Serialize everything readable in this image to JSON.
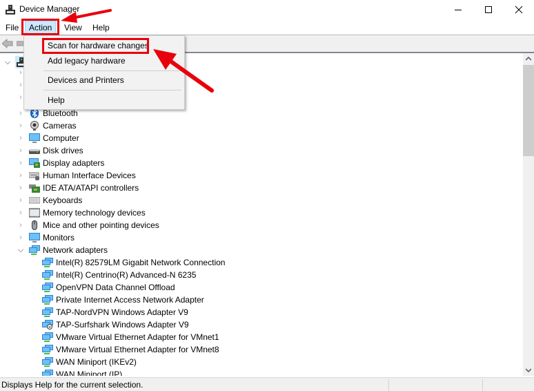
{
  "window": {
    "title": "Device Manager",
    "controls": {
      "minimize": "—",
      "maximize": "☐",
      "close": "✕"
    }
  },
  "menubar": {
    "items": [
      {
        "label": "File"
      },
      {
        "label": "Action",
        "active": true
      },
      {
        "label": "View"
      },
      {
        "label": "Help"
      }
    ]
  },
  "action_menu": {
    "items": [
      {
        "label": "Scan for hardware changes",
        "highlighted": true
      },
      {
        "label": "Add legacy hardware"
      },
      {
        "label": "Devices and Printers"
      },
      {
        "label": "Help"
      }
    ]
  },
  "tree": {
    "categories": [
      {
        "label": "Bluetooth",
        "icon": "bluetooth-icon",
        "expanded": false
      },
      {
        "label": "Cameras",
        "icon": "camera-icon",
        "expanded": false
      },
      {
        "label": "Computer",
        "icon": "computer-icon",
        "expanded": false
      },
      {
        "label": "Disk drives",
        "icon": "disk-drive-icon",
        "expanded": false
      },
      {
        "label": "Display adapters",
        "icon": "display-adapter-icon",
        "expanded": false
      },
      {
        "label": "Human Interface Devices",
        "icon": "hid-icon",
        "expanded": false
      },
      {
        "label": "IDE ATA/ATAPI controllers",
        "icon": "ide-controller-icon",
        "expanded": false
      },
      {
        "label": "Keyboards",
        "icon": "keyboard-icon",
        "expanded": false
      },
      {
        "label": "Memory technology devices",
        "icon": "memory-device-icon",
        "expanded": false
      },
      {
        "label": "Mice and other pointing devices",
        "icon": "mouse-icon",
        "expanded": false
      },
      {
        "label": "Monitors",
        "icon": "monitor-icon",
        "expanded": false
      },
      {
        "label": "Network adapters",
        "icon": "network-adapter-icon",
        "expanded": true
      }
    ],
    "network_adapters": [
      {
        "label": "Intel(R) 82579LM Gigabit Network Connection"
      },
      {
        "label": "Intel(R) Centrino(R) Advanced-N 6235"
      },
      {
        "label": "OpenVPN Data Channel Offload"
      },
      {
        "label": "Private Internet Access Network Adapter"
      },
      {
        "label": "TAP-NordVPN Windows Adapter V9"
      },
      {
        "label": "TAP-Surfshark Windows Adapter V9",
        "disabled": true
      },
      {
        "label": "VMware Virtual Ethernet Adapter for VMnet1"
      },
      {
        "label": "VMware Virtual Ethernet Adapter for VMnet8"
      },
      {
        "label": "WAN Miniport (IKEv2)"
      },
      {
        "label": "WAN Miniport (IP)"
      }
    ]
  },
  "statusbar": {
    "text": "Displays Help for the current selection."
  },
  "colors": {
    "annotation_red": "#e8000b",
    "menu_active_bg": "#cce8ff",
    "menu_active_border": "#99d1ff",
    "selection_bg": "#cce8ff"
  }
}
